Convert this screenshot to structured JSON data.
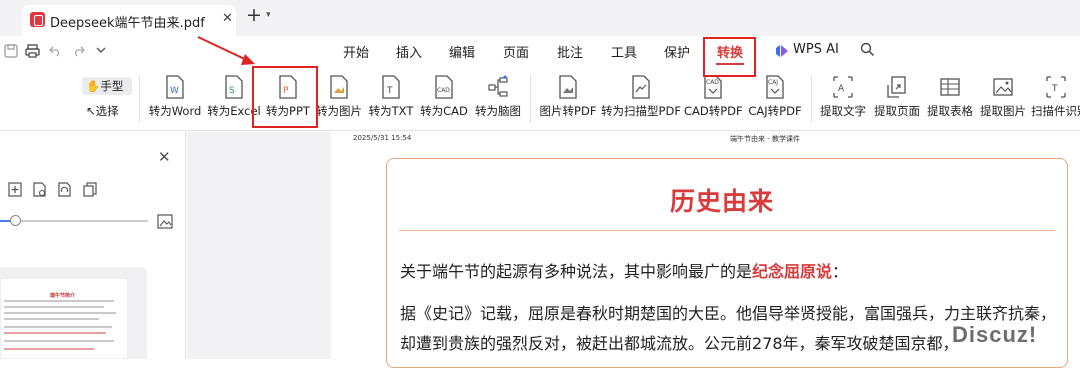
{
  "tabbar": {
    "doc_title": "Deepseek端午节由来.pdf",
    "close": "✕",
    "new_tab": "+",
    "new_tab_menu": "▾"
  },
  "menu": {
    "items": [
      "开始",
      "插入",
      "编辑",
      "页面",
      "批注",
      "工具",
      "保护",
      "转换",
      "WPS AI"
    ],
    "active": "转换"
  },
  "ribbon": {
    "hand": "手型",
    "select": "选择",
    "buttons": [
      "转为Word",
      "转为Excel",
      "转为PPT",
      "转为图片",
      "转为TXT",
      "转为CAD",
      "转为脑图",
      "图片转PDF",
      "转为扫描型PDF",
      "CAD转PDF",
      "CAJ转PDF",
      "提取文字",
      "提取页面",
      "提取表格",
      "提取图片",
      "扫描件识别"
    ],
    "highlighted": "转为PPT"
  },
  "left_panel": {
    "close": "✕",
    "thumb_title": "端午节简介"
  },
  "page": {
    "date": "2025/5/31 15:54",
    "header": "端午节由来 - 教学课件",
    "title": "历史由来",
    "p1_pre": "关于端午节的起源有多种说法，其中影响最广的是",
    "p1_hl": "纪念屈原说",
    "p1_post": "：",
    "p2": "据《史记》记载，屈原是春秋时期楚国的大臣。他倡导举贤授能，富国强兵，力主联齐抗秦，",
    "p3": "却遭到贵族的强烈反对，被赶出都城流放。公元前278年，秦军攻破楚国京都，"
  },
  "watermark": "Discuz!",
  "colors": {
    "accent": "#d73b3b",
    "annotation": "#e02222",
    "card_border": "#e8a77b"
  }
}
